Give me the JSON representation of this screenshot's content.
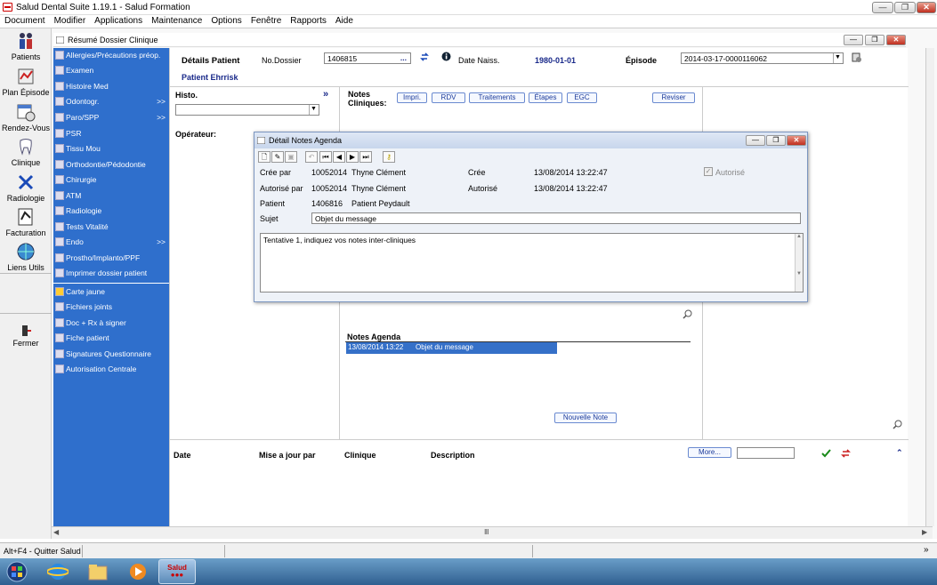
{
  "window": {
    "title": "Salud Dental Suite 1.19.1 - Salud Formation",
    "min": "—",
    "max": "❐",
    "close": "✕"
  },
  "menu": [
    "Document",
    "Modifier",
    "Applications",
    "Maintenance",
    "Options",
    "Fenêtre",
    "Rapports",
    "Aide"
  ],
  "left_nav": [
    {
      "label": "Patients",
      "icon": "patients-icon"
    },
    {
      "label": "Plan Épisode",
      "icon": "plan-icon"
    },
    {
      "label": "Rendez-Vous",
      "icon": "calendar-icon"
    },
    {
      "label": "Clinique",
      "icon": "tooth-icon"
    },
    {
      "label": "Radiologie",
      "icon": "xray-icon"
    },
    {
      "label": "Facturation",
      "icon": "billing-icon"
    },
    {
      "label": "Liens Utils",
      "icon": "globe-icon"
    },
    {
      "label": "Fermer",
      "icon": "exit-icon"
    }
  ],
  "child": {
    "title": "Résumé Dossier Clinique"
  },
  "blue_menu": [
    {
      "label": "Allergies/Précautions préop.",
      "arrow": ""
    },
    {
      "label": "Examen",
      "arrow": ""
    },
    {
      "label": "Histoire Med",
      "arrow": ""
    },
    {
      "label": "Odontogr.",
      "arrow": ">>"
    },
    {
      "label": "Paro/SPP",
      "arrow": ">>"
    },
    {
      "label": "PSR",
      "arrow": ""
    },
    {
      "label": "Tissu Mou",
      "arrow": ""
    },
    {
      "label": "Orthodontie/Pédodontie",
      "arrow": ""
    },
    {
      "label": "Chirurgie",
      "arrow": ""
    },
    {
      "label": "ATM",
      "arrow": ""
    },
    {
      "label": "Radiologie",
      "arrow": ""
    },
    {
      "label": "Tests Vitalité",
      "arrow": ""
    },
    {
      "label": "Endo",
      "arrow": ">>"
    },
    {
      "label": "Prostho/Implanto/PPF",
      "arrow": ""
    },
    {
      "label": "Imprimer dossier patient",
      "arrow": ""
    }
  ],
  "blue_menu2": [
    "Carte jaune",
    "Fichiers joints",
    "Doc + Rx à signer",
    "Fiche patient",
    "Signatures Questionnaire",
    "Autorisation Centrale"
  ],
  "patient": {
    "details_label": "Détails Patient",
    "no_dossier_label": "No.Dossier",
    "no_dossier": "1406815",
    "dots": "...",
    "dob_label": "Date Naiss.",
    "dob": "1980-01-01",
    "episode_label": "Épisode",
    "episode": "2014-03-17-0000116062",
    "name": "Patient Ehrrisk"
  },
  "histo": {
    "label": "Histo.",
    "arrow": "»",
    "operateur_label": "Opérateur:"
  },
  "notes": {
    "label": "Notes Cliniques:",
    "buttons": [
      "Impri.",
      "RDV",
      "Traitements",
      "Étapes",
      "EGC"
    ],
    "reviser": "Reviser"
  },
  "dialog": {
    "title": "Détail Notes Agenda",
    "creee_par_label": "Crée par",
    "creee_par_id": "10052014",
    "creee_par_name": "Thyne Clément",
    "cree_label": "Crée",
    "cree_date": "13/08/2014 13:22:47",
    "autorise_par_label": "Autorisé par",
    "autorise_par_id": "10052014",
    "autorise_par_name": "Thyne Clément",
    "autorise_label": "Autorisé",
    "autorise_date": "13/08/2014 13:22:47",
    "patient_label": "Patient",
    "patient_id": "1406816",
    "patient_name": "Patient Peydault",
    "sujet_label": "Sujet",
    "sujet": "Objet du message",
    "body": "Tentative 1, indiquez vos notes inter-cliniques",
    "autorise_check": "Autorisé"
  },
  "agenda": {
    "header": "Notes Agenda",
    "row_date": "13/08/2014 13:22",
    "row_subject": "Objet du message",
    "new_note": "Nouvelle Note"
  },
  "table": {
    "columns": [
      "Date",
      "Mise a jour par",
      "Clinique",
      "Description"
    ],
    "more": "More..."
  },
  "status": {
    "text": "Alt+F4 - Quitter Salud"
  },
  "taskbar": {
    "salud_label": "Salud"
  }
}
